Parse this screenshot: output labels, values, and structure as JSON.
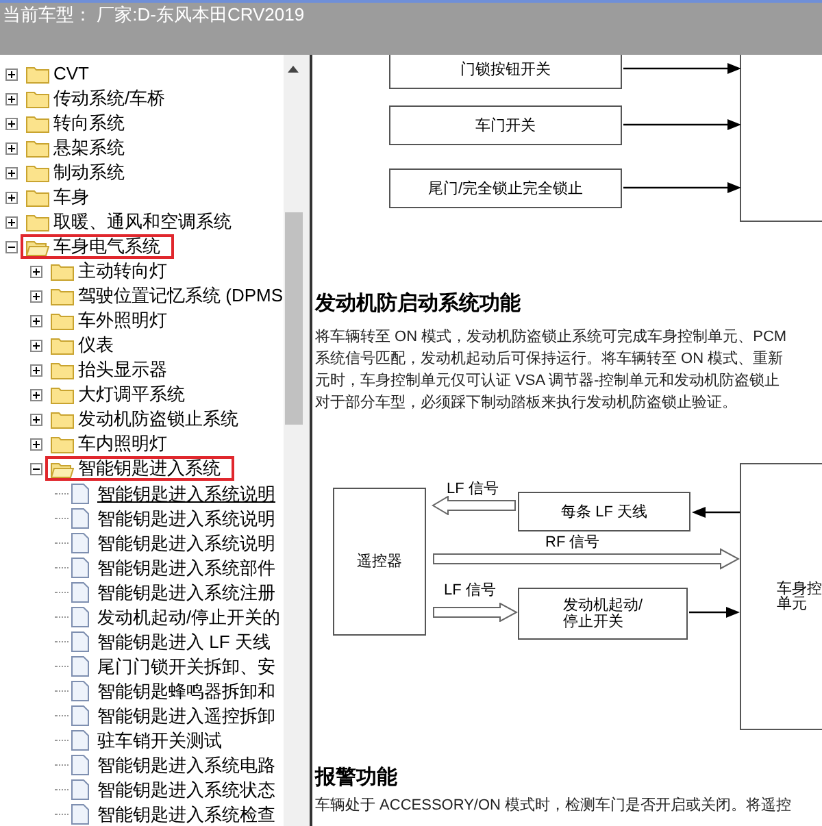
{
  "header": {
    "title": "当前车型： 厂家:D-东风本田CRV2019"
  },
  "tree": [
    {
      "label": "CVT",
      "expanded": false,
      "highlighted": false
    },
    {
      "label": "传动系统/车桥",
      "expanded": false,
      "highlighted": false
    },
    {
      "label": "转向系统",
      "expanded": false,
      "highlighted": false
    },
    {
      "label": "悬架系统",
      "expanded": false,
      "highlighted": false
    },
    {
      "label": "制动系统",
      "expanded": false,
      "highlighted": false
    },
    {
      "label": "车身",
      "expanded": false,
      "highlighted": false
    },
    {
      "label": "取暖、通风和空调系统",
      "expanded": false,
      "highlighted": false
    },
    {
      "label": "车身电气系统",
      "expanded": true,
      "highlighted": true,
      "children": [
        {
          "label": "主动转向灯",
          "expanded": false,
          "highlighted": false
        },
        {
          "label": "驾驶位置记忆系统 (DPMS",
          "expanded": false,
          "highlighted": false
        },
        {
          "label": "车外照明灯",
          "expanded": false,
          "highlighted": false
        },
        {
          "label": "仪表",
          "expanded": false,
          "highlighted": false
        },
        {
          "label": "抬头显示器",
          "expanded": false,
          "highlighted": false
        },
        {
          "label": "大灯调平系统",
          "expanded": false,
          "highlighted": false
        },
        {
          "label": "发动机防盗锁止系统",
          "expanded": false,
          "highlighted": false
        },
        {
          "label": "车内照明灯",
          "expanded": false,
          "highlighted": false
        },
        {
          "label": "智能钥匙进入系统",
          "expanded": true,
          "highlighted": true,
          "children": [
            {
              "label": "智能钥匙进入系统说明",
              "selected": true
            },
            {
              "label": "智能钥匙进入系统说明",
              "selected": false
            },
            {
              "label": "智能钥匙进入系统说明",
              "selected": false
            },
            {
              "label": "智能钥匙进入系统部件",
              "selected": false
            },
            {
              "label": "智能钥匙进入系统注册",
              "selected": false
            },
            {
              "label": "发动机起动/停止开关的",
              "selected": false
            },
            {
              "label": "智能钥匙进入 LF 天线",
              "selected": false
            },
            {
              "label": "尾门门锁开关拆卸、安",
              "selected": false
            },
            {
              "label": "智能钥匙蜂鸣器拆卸和",
              "selected": false
            },
            {
              "label": "智能钥匙进入遥控拆卸",
              "selected": false
            },
            {
              "label": "驻车销开关测试",
              "selected": false
            },
            {
              "label": "智能钥匙进入系统电路",
              "selected": false
            },
            {
              "label": "智能钥匙进入系统状态",
              "selected": false
            },
            {
              "label": "智能钥匙进入系统检查",
              "selected": false
            }
          ]
        }
      ]
    }
  ],
  "content": {
    "diagram_1": {
      "inputs": [
        "门锁按钮开关",
        "车门开关",
        "尾门/完全锁止完全锁止"
      ]
    },
    "section_1": {
      "heading": "发动机防启动系统功能",
      "lines": [
        "将车辆转至 ON 模式，发动机防盗锁止系统可完成车身控制单元、PCM",
        "系统信号匹配，发动机起动后可保持运行。将车辆转至 ON 模式、重新",
        "元时，车身控制单元仅可认证 VSA 调节器-控制单元和发动机防盗锁止",
        "对于部分车型，必须踩下制动踏板来执行发动机防盗锁止验证。"
      ]
    },
    "diagram_2": {
      "remote": "遥控器",
      "antenna": "每条 LF 天线",
      "switch_lines": [
        "发动机起动/",
        "停止开关"
      ],
      "unit_lines": [
        "车身控",
        "单元"
      ],
      "lf_signal_top": "LF 信号",
      "rf_signal": "RF 信号",
      "lf_signal_bottom": "LF 信号"
    },
    "section_2": {
      "heading": "报警功能",
      "lines": [
        "车辆处于 ACCESSORY/ON 模式时，检测车门是否开启或关闭。将遥控"
      ]
    }
  }
}
